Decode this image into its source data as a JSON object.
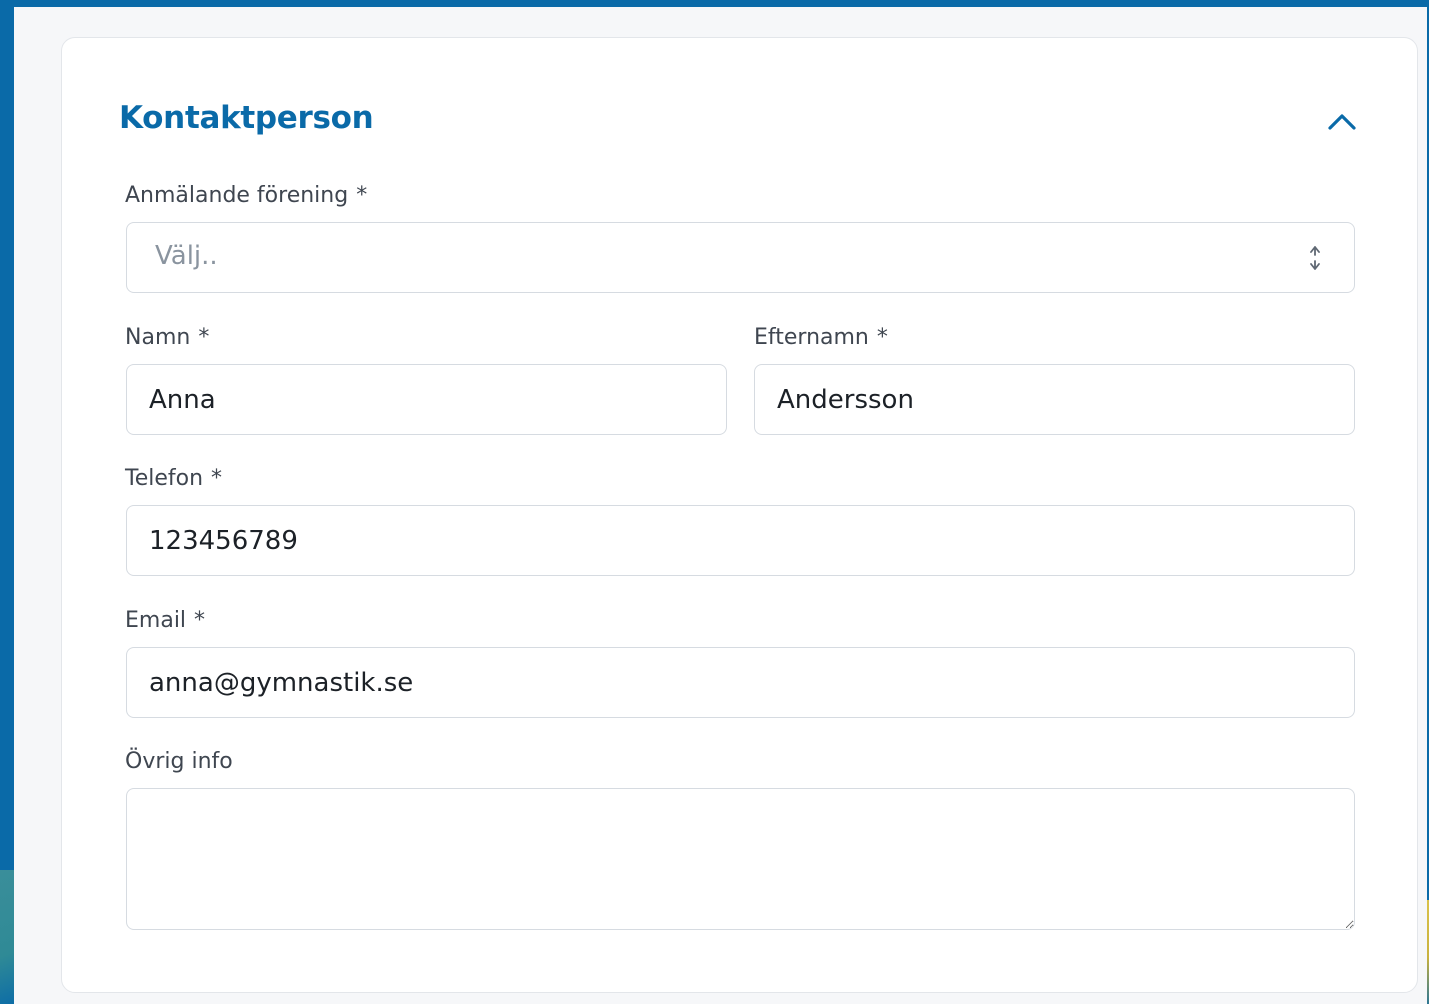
{
  "section": {
    "title": "Kontaktperson"
  },
  "colors": {
    "accent": "#0a6aa8",
    "label": "#3f4650",
    "border": "#d6dbe1",
    "placeholder": "#8a949f"
  },
  "icons": {
    "collapse": "chevron-up-icon",
    "select": "up-down-arrows-icon",
    "resize": "resize-grip-icon"
  },
  "fields": {
    "forening": {
      "label": "Anmälande förening",
      "required_mark": "*",
      "placeholder": "Välj.."
    },
    "namn": {
      "label": "Namn",
      "required_mark": "*",
      "value": "Anna"
    },
    "efternamn": {
      "label": "Efternamn",
      "required_mark": "*",
      "value": "Andersson"
    },
    "telefon": {
      "label": "Telefon",
      "required_mark": "*",
      "value": "123456789"
    },
    "email": {
      "label": "Email",
      "required_mark": "*",
      "value": "anna@gymnastik.se"
    },
    "ovrig": {
      "label": "Övrig info",
      "value": ""
    }
  }
}
